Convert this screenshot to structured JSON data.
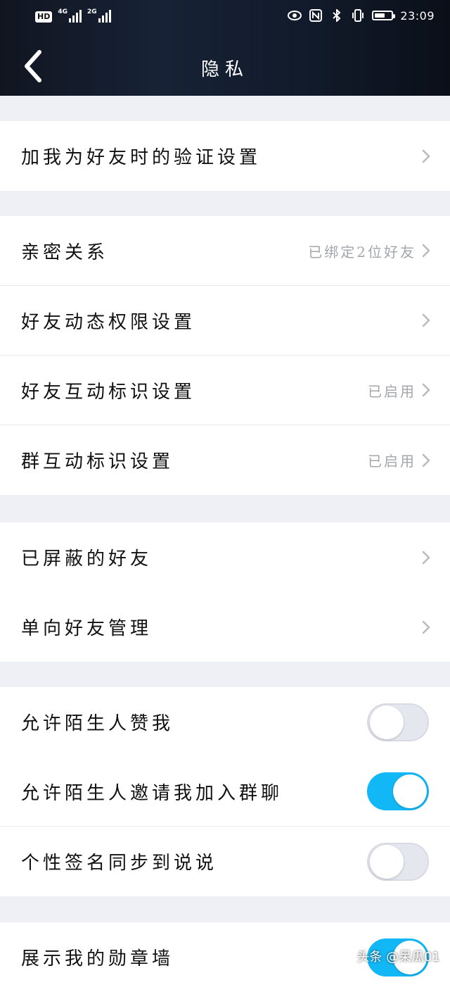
{
  "status_bar": {
    "hd": "HD",
    "net1": "4G",
    "net2": "2G",
    "time": "23:09"
  },
  "header": {
    "title": "隐私"
  },
  "groups": [
    {
      "items": [
        {
          "label": "加我为好友时的验证设置",
          "type": "link"
        }
      ]
    },
    {
      "items": [
        {
          "label": "亲密关系",
          "value": "已绑定2位好友",
          "type": "link"
        },
        {
          "label": "好友动态权限设置",
          "type": "link"
        },
        {
          "label": "好友互动标识设置",
          "value": "已启用",
          "type": "link"
        },
        {
          "label": "群互动标识设置",
          "value": "已启用",
          "type": "link"
        }
      ]
    },
    {
      "items": [
        {
          "label": "已屏蔽的好友",
          "type": "link"
        },
        {
          "label": "单向好友管理",
          "type": "link"
        }
      ]
    },
    {
      "items": [
        {
          "label": "允许陌生人赞我",
          "type": "toggle",
          "enabled": false
        },
        {
          "label": "允许陌生人邀请我加入群聊",
          "type": "toggle",
          "enabled": true
        },
        {
          "label": "个性签名同步到说说",
          "type": "toggle",
          "enabled": false
        }
      ]
    },
    {
      "items": [
        {
          "label": "展示我的勋章墙",
          "type": "toggle",
          "enabled": true
        }
      ]
    }
  ],
  "watermark": "头条 @呆瓜01",
  "colors": {
    "accent": "#12b7f5",
    "background": "#eef0f5",
    "header": "#111827"
  }
}
